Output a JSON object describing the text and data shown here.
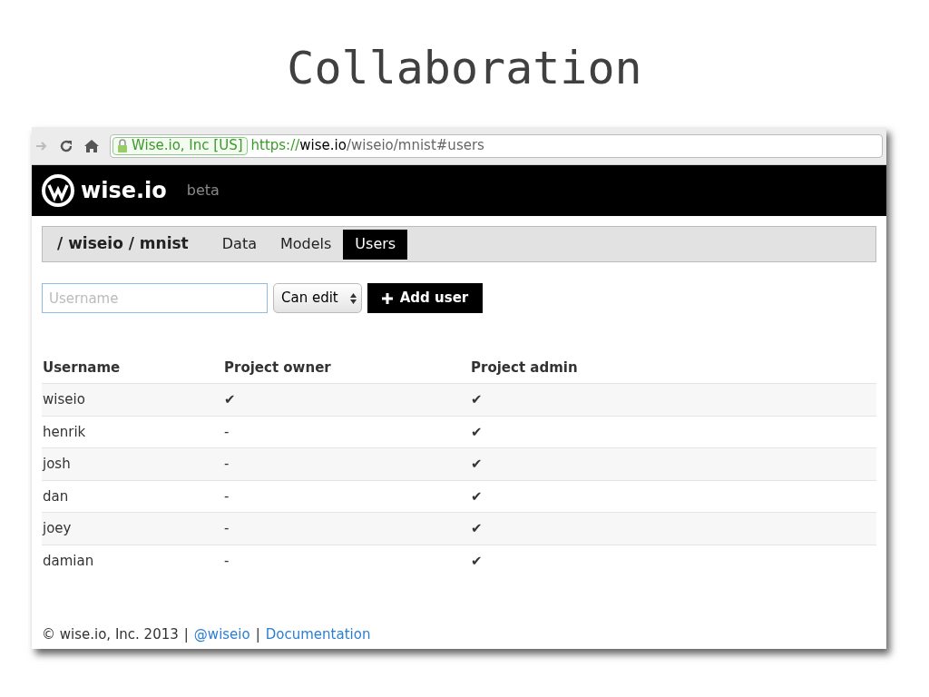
{
  "slide_title": "Collaboration",
  "browser": {
    "identity": "Wise.io, Inc [US]",
    "url_scheme": "https://",
    "url_host": "wise.io",
    "url_path": "/wiseio/mnist#users"
  },
  "header": {
    "brand": "wise.io",
    "tag": "beta"
  },
  "project": {
    "breadcrumb": "/ wiseio / mnist",
    "tabs": [
      {
        "label": "Data",
        "selected": false
      },
      {
        "label": "Models",
        "selected": false
      },
      {
        "label": "Users",
        "selected": true
      }
    ]
  },
  "add_form": {
    "placeholder": "Username",
    "permission": "Can edit",
    "button": "Add user"
  },
  "table": {
    "columns": [
      "Username",
      "Project owner",
      "Project admin"
    ],
    "rows": [
      {
        "username": "wiseio",
        "owner": "✔",
        "admin": "✔"
      },
      {
        "username": "henrik",
        "owner": "-",
        "admin": "✔"
      },
      {
        "username": "josh",
        "owner": "-",
        "admin": "✔"
      },
      {
        "username": "dan",
        "owner": "-",
        "admin": "✔"
      },
      {
        "username": "joey",
        "owner": "-",
        "admin": "✔"
      },
      {
        "username": "damian",
        "owner": "-",
        "admin": "✔"
      }
    ]
  },
  "footer": {
    "copyright": "© wise.io, Inc. 2013",
    "separator_1": "|",
    "twitter": "@wiseio",
    "separator_2": "|",
    "docs": "Documentation"
  }
}
